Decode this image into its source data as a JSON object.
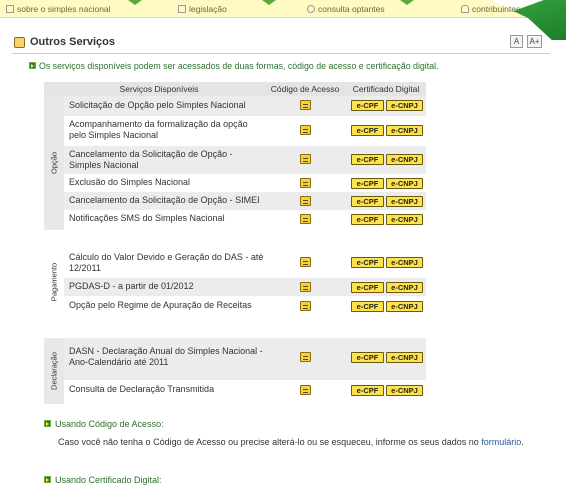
{
  "topnav": {
    "items": [
      {
        "label": "sobre o simples nacional",
        "icon": "document-icon"
      },
      {
        "label": "legislação",
        "icon": "book-icon"
      },
      {
        "label": "consulta optantes",
        "icon": "search-icon"
      },
      {
        "label": "contribuintes",
        "icon": "lock-icon"
      }
    ]
  },
  "header": {
    "title": "Outros Serviços",
    "font_decrease": "A",
    "font_increase": "A+"
  },
  "intro": "Os serviços disponíveis podem ser acessados de duas formas, código de acesso e certificação digital.",
  "table": {
    "col_services": "Serviços Disponíveis",
    "col_code": "Código de Acesso",
    "col_cert": "Certificado Digital",
    "cert_cpf": "e-CPF",
    "cert_cnpj": "e-CNPJ",
    "groups": [
      {
        "name": "Opção",
        "rows": [
          "Solicitação de Opção pelo Simples Nacional",
          "Acompanhamento da formalização da opção pelo Simples Nacional",
          "Cancelamento da Solicitação de Opção - Simples Nacional",
          "Exclusão do Simples Nacional",
          "Cancelamento da Solicitação de Opção - SIMEI",
          "Notificações SMS do Simples Nacional"
        ]
      },
      {
        "name": "Pagamento",
        "rows": [
          "Cálculo do Valor Devido e Geração do DAS - até 12/2011",
          "PGDAS-D - a partir de 01/2012",
          "Opção pelo Regime de Apuração de Receitas"
        ]
      },
      {
        "name": "Declaração",
        "rows": [
          "DASN - Declaração Anual do Simples Nacional - Ano-Calendário até 2011",
          "Consulta de Declaração Transmitida"
        ]
      }
    ]
  },
  "using_code": {
    "heading": "Usando Código de Acesso:",
    "text": "Caso você não tenha o Código de Acesso ou precise alterá-lo ou se esqueceu, informe os seus dados no",
    "link": "formulário",
    "end": "."
  },
  "using_cert": {
    "heading": "Usando Certificado Digital:"
  }
}
